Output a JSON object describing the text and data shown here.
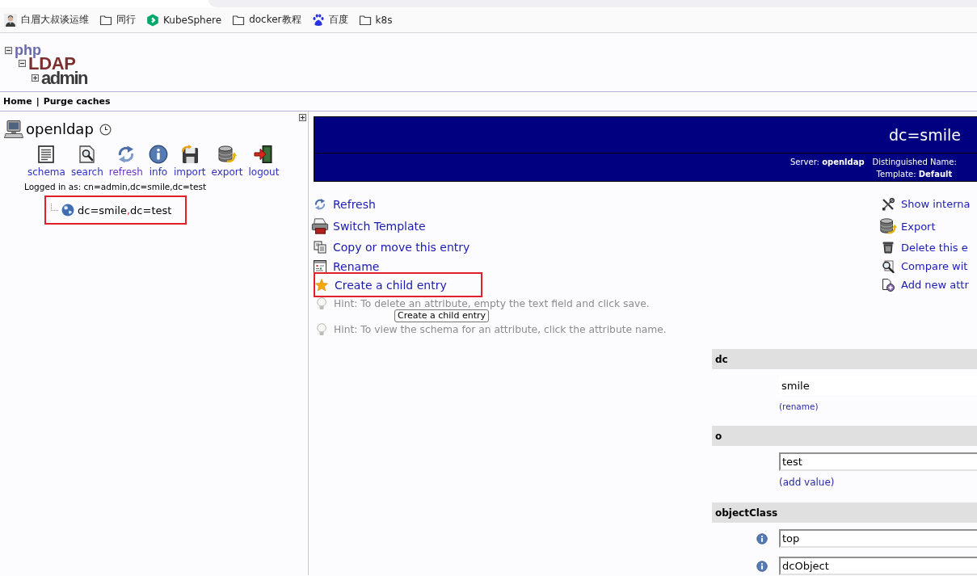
{
  "browser": {
    "bookmarks": [
      {
        "kind": "person",
        "label": "白眉大叔谈运维"
      },
      {
        "kind": "folder",
        "label": "同行"
      },
      {
        "kind": "hexagon",
        "label": "KubeSphere"
      },
      {
        "kind": "folder",
        "label": "docker教程"
      },
      {
        "kind": "paw",
        "label": "百度"
      },
      {
        "kind": "folder",
        "label": "k8s"
      }
    ]
  },
  "logo": {
    "parts": [
      "php",
      "LDAP",
      "admin"
    ]
  },
  "nav": {
    "links": [
      "Home",
      "Purge caches"
    ],
    "separator": "|"
  },
  "server": {
    "name": "openldap",
    "toolbar": [
      {
        "kind": "schema",
        "label": "schema",
        "visited": false
      },
      {
        "kind": "search",
        "label": "search",
        "visited": false
      },
      {
        "kind": "refresh",
        "label": "refresh",
        "visited": true
      },
      {
        "kind": "info",
        "label": "info",
        "visited": false
      },
      {
        "kind": "import",
        "label": "import",
        "visited": false
      },
      {
        "kind": "export",
        "label": "export",
        "visited": false
      },
      {
        "kind": "logout",
        "label": "logout",
        "visited": false
      }
    ],
    "logged_in": "Logged in as: cn=admin,dc=smile,dc=test",
    "tree": [
      {
        "label_parts": [
          "dc=smile",
          ",",
          "dc=test"
        ],
        "highlighted": true
      }
    ]
  },
  "entry": {
    "title": "dc=smile",
    "server": "Server: **openldap**",
    "dn": "Distinguished Name:",
    "template": "Template: **Default**",
    "actions_left": [
      {
        "kind": "refresh",
        "label": "Refresh",
        "highlighted": false
      },
      {
        "kind": "template",
        "label": "Switch Template",
        "highlighted": false
      },
      {
        "kind": "copy",
        "label": "Copy or move this entry",
        "highlighted": false
      },
      {
        "kind": "rename",
        "label": "Rename",
        "highlighted": false
      },
      {
        "kind": "create",
        "label": "Create a child entry",
        "highlighted": true
      }
    ],
    "actions_right": [
      {
        "kind": "internal",
        "label": "Show interna",
        "highlighted": false
      },
      {
        "kind": "export",
        "label": "Export",
        "highlighted": false
      },
      {
        "kind": "delete",
        "label": "Delete this e",
        "highlighted": false
      },
      {
        "kind": "compare",
        "label": "Compare wit",
        "highlighted": false
      },
      {
        "kind": "add_attr",
        "label": "Add new attr",
        "highlighted": false
      }
    ],
    "hints": [
      "Hint: To delete an attribute, empty the text field and click save.",
      "Hint: To view the schema for an attribute, click the attribute name."
    ],
    "tooltip": "Create a child entry",
    "attributes": [
      {
        "name": "dc",
        "values": [
          {
            "kind": "readonly",
            "value": "smile",
            "info": false
          }
        ],
        "link": {
          "kind": "rename",
          "label": "(rename)"
        }
      },
      {
        "name": "o",
        "values": [
          {
            "kind": "input",
            "value": "test",
            "info": false
          }
        ],
        "link": {
          "kind": "add",
          "label": "(add value)"
        }
      },
      {
        "name": "objectClass",
        "values": [
          {
            "kind": "input",
            "value": "top",
            "info": true
          },
          {
            "kind": "input",
            "value": "dcObject",
            "info": true
          }
        ]
      }
    ]
  }
}
